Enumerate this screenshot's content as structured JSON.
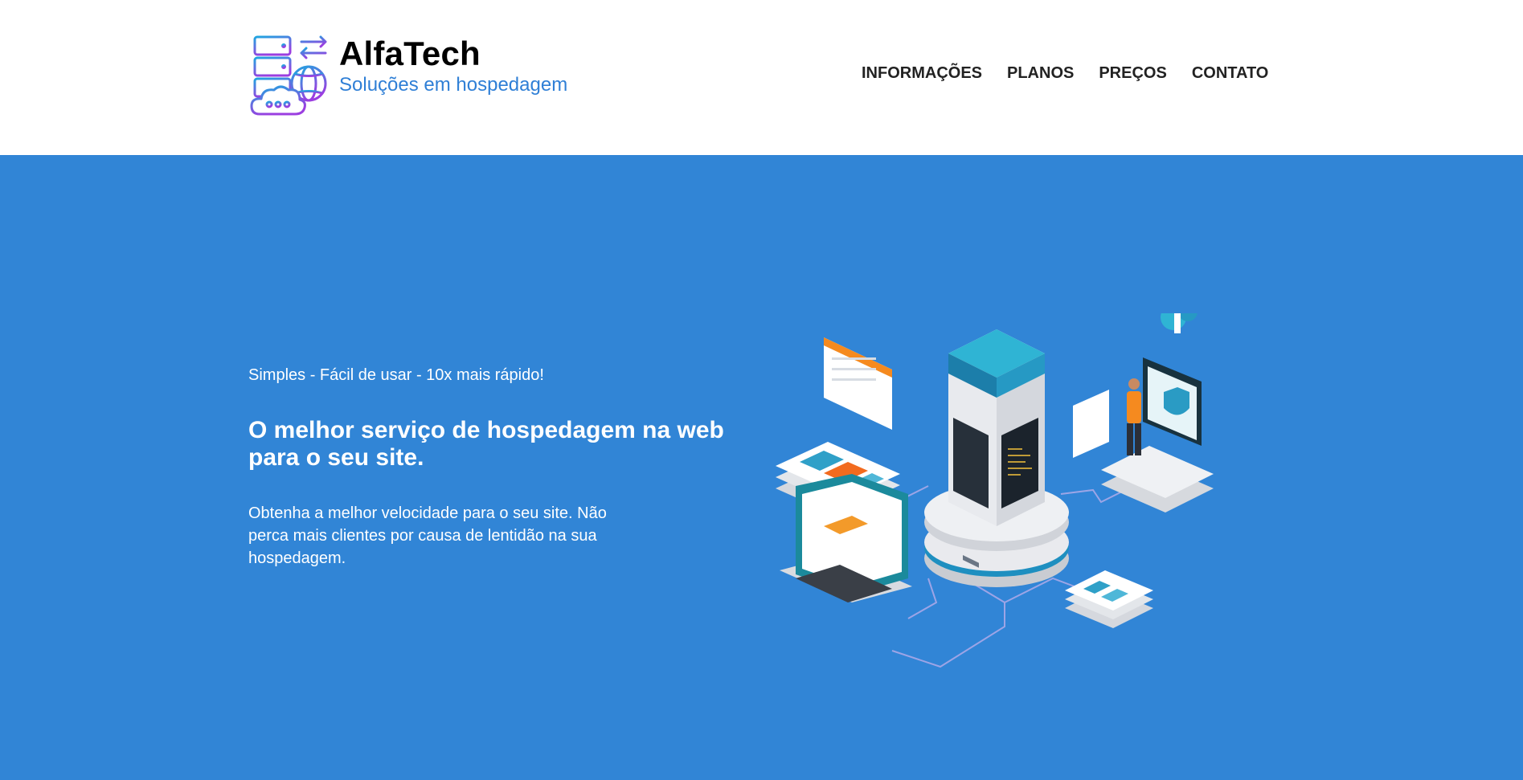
{
  "brand": {
    "name": "AlfaTech",
    "tagline": "Soluções em hospedagem"
  },
  "nav": {
    "items": [
      "INFORMAÇÕES",
      "PLANOS",
      "PREÇOS",
      "CONTATO"
    ]
  },
  "hero": {
    "tagline": "Simples - Fácil de usar - 10x mais rápido!",
    "title": "O melhor serviço de hospedagem na web para o seu site.",
    "description": "Obtenha a melhor velocidade para o seu site. Não perca mais clientes por causa de lentidão na sua hospedagem."
  },
  "colors": {
    "hero_background": "#3185d6",
    "brand_accent": "#2f7fd6",
    "nav_text": "#222222"
  },
  "icons": {
    "logo": "server-globe-cloud-icon",
    "illustration": "hosting-network-illustration"
  }
}
